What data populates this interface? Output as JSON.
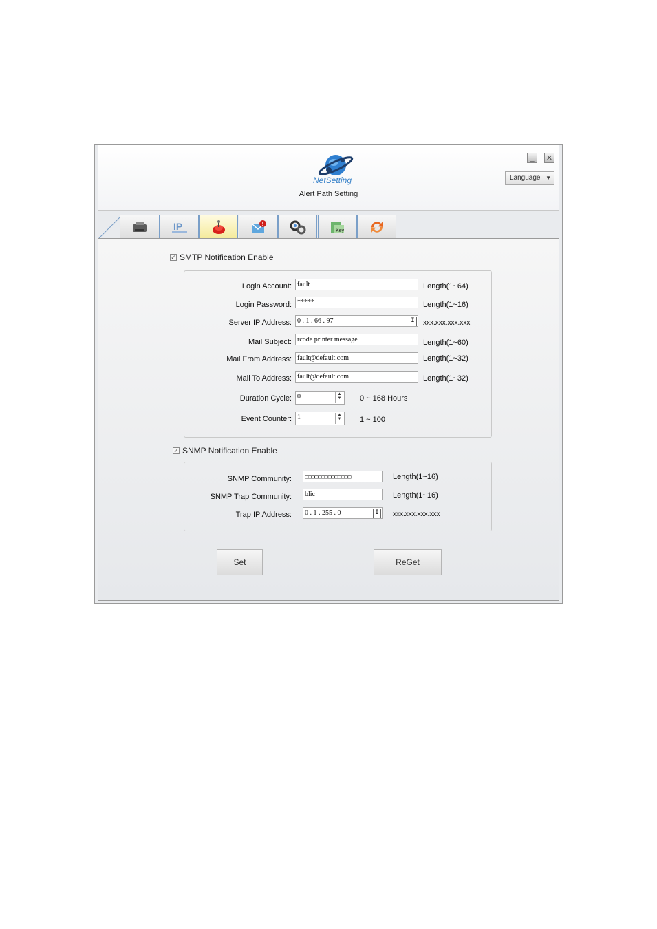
{
  "header": {
    "logo_text": "NetSetting",
    "subtitle": "Alert Path Setting",
    "language_label": "Language"
  },
  "tabs": [
    {
      "icon": "printer-icon"
    },
    {
      "icon": "ip-network-icon"
    },
    {
      "icon": "alert-path-icon",
      "active": true
    },
    {
      "icon": "mail-alert-icon"
    },
    {
      "icon": "settings-gears-icon"
    },
    {
      "icon": "key-icon"
    },
    {
      "icon": "refresh-icon"
    }
  ],
  "smtp": {
    "enable_label": "SMTP Notification Enable",
    "fields": [
      {
        "label": "Login Account:",
        "value": "fault",
        "hint": "Length(1~64)"
      },
      {
        "label": "Login Password:",
        "value": "*****",
        "hint": "Length(1~16)"
      },
      {
        "label": "Server IP Address:",
        "value": "0 . 1 . 66 . 97",
        "hint": "xxx.xxx.xxx.xxx"
      },
      {
        "label": "Mail Subject:",
        "value": "rcode printer message",
        "hint": "Length(1~60)"
      },
      {
        "label": "Mail From Address:",
        "value": "fault@default.com",
        "hint": "Length(1~32)"
      },
      {
        "label": "Mail To Address:",
        "value": "fault@default.com",
        "hint": "Length(1~32)"
      },
      {
        "label": "Duration Cycle:",
        "value": "0",
        "hint": "0 ~ 168 Hours"
      },
      {
        "label": "Event Counter:",
        "value": "1",
        "hint": "1 ~ 100"
      }
    ]
  },
  "snmp": {
    "enable_label": "SNMP Notification Enable",
    "fields": [
      {
        "label": "SNMP Community:",
        "value": "□□□□□□□□□□□□□□",
        "hint": "Length(1~16)"
      },
      {
        "label": "SNMP Trap Community:",
        "value": "blic",
        "hint": "Length(1~16)"
      },
      {
        "label": "Trap IP Address:",
        "value": "0 . 1 . 255 . 0",
        "hint": "xxx.xxx.xxx.xxx"
      }
    ]
  },
  "buttons": {
    "set": "Set",
    "reget": "ReGet"
  },
  "ip_button_glyph": "I"
}
